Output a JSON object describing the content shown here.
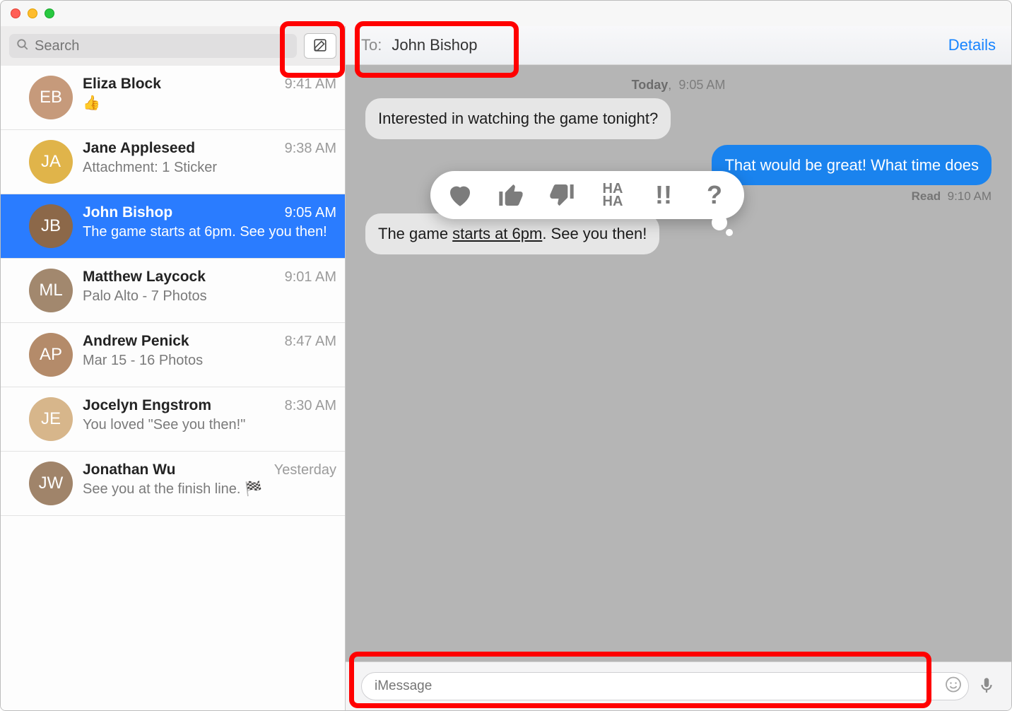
{
  "search": {
    "placeholder": "Search"
  },
  "sidebar": {
    "conversations": [
      {
        "name": "Eliza Block",
        "time": "9:41 AM",
        "preview": "👍",
        "avatarColor": "#c69a7b"
      },
      {
        "name": "Jane Appleseed",
        "time": "9:38 AM",
        "preview": "Attachment: 1 Sticker",
        "avatarColor": "#e0b44a"
      },
      {
        "name": "John Bishop",
        "time": "9:05 AM",
        "preview": "The game starts at 6pm. See you then!",
        "avatarColor": "#8c6849"
      },
      {
        "name": "Matthew Laycock",
        "time": "9:01 AM",
        "preview": "Palo Alto - 7 Photos",
        "avatarColor": "#a2886e"
      },
      {
        "name": "Andrew Penick",
        "time": "8:47 AM",
        "preview": "Mar 15 - 16 Photos",
        "avatarColor": "#b48b6a"
      },
      {
        "name": "Jocelyn Engstrom",
        "time": "8:30 AM",
        "preview": "You loved \"See you then!\"",
        "avatarColor": "#d7b68b"
      },
      {
        "name": "Jonathan Wu",
        "time": "Yesterday",
        "preview": "See you at the finish line. 🏁",
        "avatarColor": "#a0846a"
      }
    ],
    "selected_index": 2
  },
  "header": {
    "to_label": "To:",
    "to_name": "John Bishop",
    "details": "Details"
  },
  "thread": {
    "date_label_bold": "Today",
    "date_label_time": "9:05 AM",
    "messages": [
      {
        "dir": "in",
        "text": "Interested in watching the game tonight?"
      },
      {
        "dir": "out",
        "text": "That would be great! What time does"
      },
      {
        "dir": "in",
        "text": "The game starts at 6pm. See you then!"
      }
    ],
    "read_label": "Read",
    "read_time": "9:10 AM"
  },
  "tapbacks": {
    "heart": "heart",
    "thumbs_up": "thumbs-up",
    "thumbs_down": "thumbs-down",
    "haha": "HA HA",
    "exclaim": "!!",
    "question": "?"
  },
  "compose": {
    "placeholder": "iMessage"
  }
}
